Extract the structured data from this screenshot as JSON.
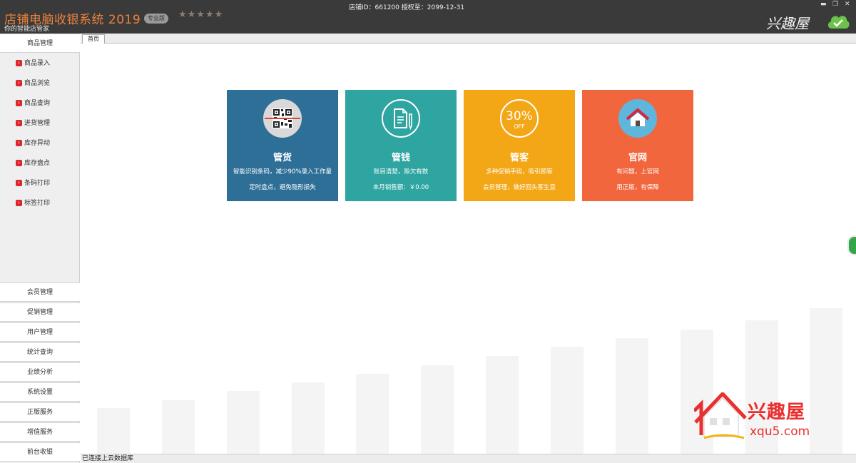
{
  "titlebar": {
    "app_title": "店铺电脑收银系统 2019",
    "edition": "专业版",
    "stars": "★★★★★",
    "subtitle": "你的智能店管家",
    "store_info": "店铺ID：661200 授权至：2099-12-31",
    "minimize": "▬",
    "restore": "❐",
    "close": "✕",
    "brand": "兴趣屋"
  },
  "sidebar": {
    "active_section": "商品管理",
    "sub_items": [
      "商品录入",
      "商品浏览",
      "商品查询",
      "进货管理",
      "库存异动",
      "库存盘点",
      "条码打印",
      "标签打印"
    ],
    "sections": [
      "会员管理",
      "促销管理",
      "用户管理",
      "统计查询",
      "业绩分析",
      "系统设置",
      "正版服务",
      "增值服务",
      "前台收银"
    ]
  },
  "tabs": {
    "home": "首页"
  },
  "cards": [
    {
      "title": "管货",
      "line1": "智能识别条码，减少90%录入工作量",
      "line2": "定时盘点，避免隐形损失",
      "color": "#2e6f97"
    },
    {
      "title": "管钱",
      "line1": "账目清楚，赊欠有数",
      "line2": "本月销售额：￥0.00",
      "color": "#2fa5a1"
    },
    {
      "title": "管客",
      "line1": "多种促销手段，吸引顾客",
      "line2": "会员管理，做好回头客生意",
      "color": "#f3a716",
      "badge_value": "30%",
      "badge_text": "OFF"
    },
    {
      "title": "官网",
      "line1": "有问题，上官网",
      "line2": "用正版，有保障",
      "color": "#f2663d"
    }
  ],
  "watermark": {
    "name": "兴趣屋",
    "url": "xqu5.com"
  },
  "statusbar": {
    "text": "已连接上云数据库"
  }
}
